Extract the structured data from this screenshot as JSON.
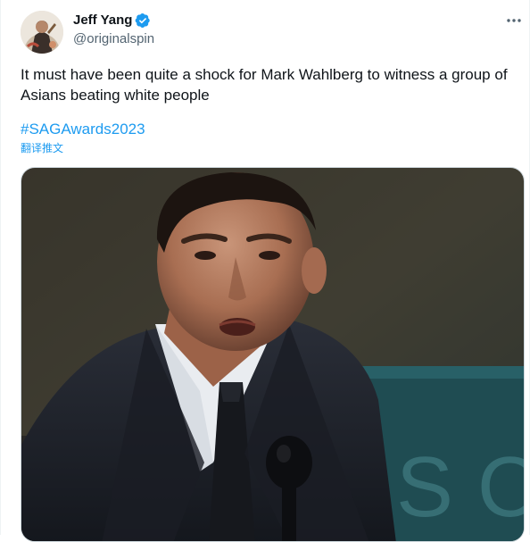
{
  "author": {
    "name": "Jeff Yang",
    "handle": "@originalspin",
    "verified": true,
    "verified_color": "#1d9bf0"
  },
  "tweet": {
    "text": "It must have been quite a shock for Mark Wahlberg to witness a group of Asians beating white people",
    "hashtag": "#SAGAwards2023",
    "translate_label": "翻译推文"
  },
  "menu": {
    "more_icon": "more-horizontal-icon"
  },
  "media": {
    "type": "video-still",
    "background_letters": "S C"
  },
  "colors": {
    "link": "#1d9bf0",
    "text_primary": "#0f1419",
    "text_secondary": "#536471"
  }
}
